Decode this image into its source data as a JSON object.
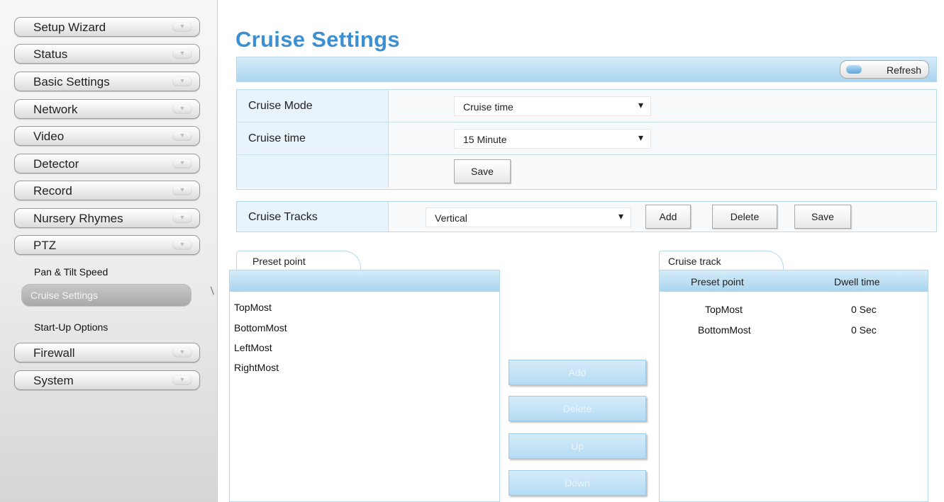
{
  "sidebar": {
    "items": [
      {
        "label": "Setup Wizard"
      },
      {
        "label": "Status"
      },
      {
        "label": "Basic Settings"
      },
      {
        "label": "Network"
      },
      {
        "label": "Video"
      },
      {
        "label": "Detector"
      },
      {
        "label": "Record"
      },
      {
        "label": "Nursery Rhymes"
      },
      {
        "label": "PTZ"
      }
    ],
    "ptz_sub": {
      "pan_tilt": "Pan & Tilt Speed",
      "cruise": "Cruise Settings",
      "startup": "Start-Up Options"
    },
    "items_after": [
      {
        "label": "Firewall"
      },
      {
        "label": "System"
      }
    ]
  },
  "page": {
    "title": "Cruise Settings",
    "refresh_label": "Refresh"
  },
  "form": {
    "cruise_mode": {
      "label": "Cruise Mode",
      "value": "Cruise time"
    },
    "cruise_time": {
      "label": "Cruise time",
      "value": "15 Minute"
    },
    "save_label": "Save"
  },
  "tracks": {
    "label": "Cruise Tracks",
    "value": "Vertical",
    "add_label": "Add",
    "delete_label": "Delete",
    "save_label": "Save"
  },
  "preset": {
    "tab_label": "Preset point",
    "points": [
      "TopMost",
      "BottomMost",
      "LeftMost",
      "RightMost"
    ]
  },
  "actions": {
    "add": "Add",
    "delete": "Delete",
    "up": "Up",
    "down": "Down"
  },
  "cruise_track": {
    "tab_label": "Cruise track",
    "col_preset": "Preset point",
    "col_dwell": "Dwell time",
    "rows": [
      {
        "point": "TopMost",
        "dwell": "0 Sec"
      },
      {
        "point": "BottomMost",
        "dwell": "0 Sec"
      }
    ]
  },
  "colors": {
    "accent": "#3c8fd1",
    "header_blue": "#a9d4ef",
    "label_cell": "#e8f3fb"
  }
}
